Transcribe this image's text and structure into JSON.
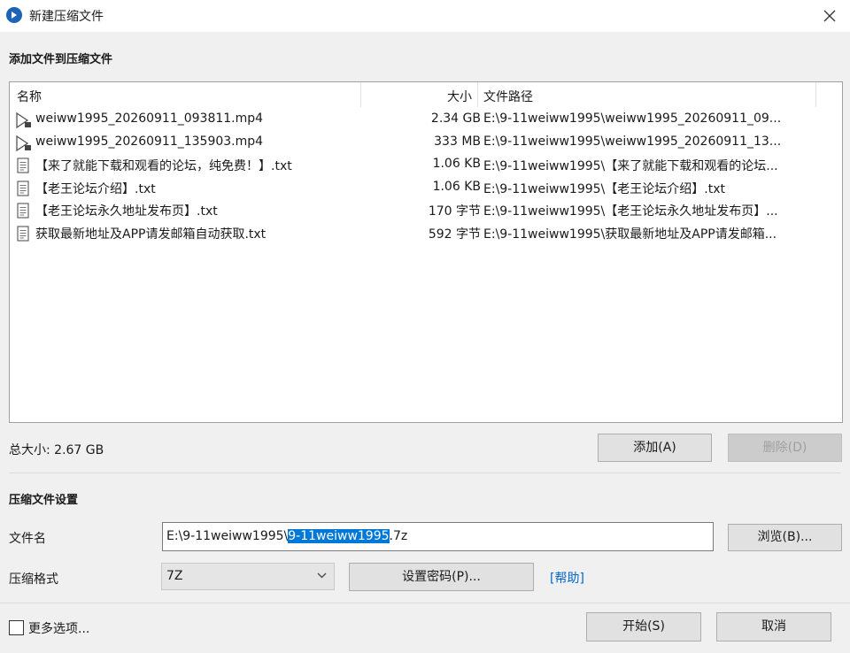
{
  "window": {
    "title": "新建压缩文件",
    "close_icon": "close-icon",
    "app_icon": "app-logo-icon"
  },
  "add_section": {
    "title": "添加文件到压缩文件"
  },
  "file_list": {
    "columns": {
      "name": "名称",
      "size": "大小",
      "path": "文件路径"
    },
    "rows": [
      {
        "icon": "video-file-icon",
        "name": "weiww1995_20260911_093811.mp4",
        "size": "2.34 GB",
        "path": "E:\\9-11weiww1995\\weiww1995_20260911_09..."
      },
      {
        "icon": "video-file-icon",
        "name": "weiww1995_20260911_135903.mp4",
        "size": "333 MB",
        "path": "E:\\9-11weiww1995\\weiww1995_20260911_13..."
      },
      {
        "icon": "text-file-icon",
        "name": "【来了就能下载和观看的论坛，纯免费！】.txt",
        "size": "1.06 KB",
        "path": "E:\\9-11weiww1995\\【来了就能下载和观看的论坛..."
      },
      {
        "icon": "text-file-icon",
        "name": "【老王论坛介绍】.txt",
        "size": "1.06 KB",
        "path": "E:\\9-11weiww1995\\【老王论坛介绍】.txt"
      },
      {
        "icon": "text-file-icon",
        "name": "【老王论坛永久地址发布页】.txt",
        "size": "170 字节",
        "path": "E:\\9-11weiww1995\\【老王论坛永久地址发布页】..."
      },
      {
        "icon": "text-file-icon",
        "name": "获取最新地址及APP请发邮箱自动获取.txt",
        "size": "592 字节",
        "path": "E:\\9-11weiww1995\\获取最新地址及APP请发邮箱..."
      }
    ]
  },
  "summary": {
    "total": "总大小: 2.67 GB"
  },
  "buttons": {
    "add": "添加(A)",
    "delete": "删除(D)",
    "browse": "浏览(B)...",
    "set_password": "设置密码(P)...",
    "start": "开始(S)",
    "cancel": "取消"
  },
  "settings": {
    "title": "压缩文件设置",
    "filename_label": "文件名",
    "filename_prefix": "E:\\9-11weiww1995\\",
    "filename_selected": "9-11weiww1995",
    "filename_suffix": ".7z",
    "format_label": "压缩格式",
    "format_value": "7Z",
    "help_link": "[帮助]"
  },
  "more_options": {
    "label": "更多选项...",
    "checked": false
  },
  "colors": {
    "selection": "#0078d7",
    "link": "#0066cc",
    "app_icon": "#1d63b8"
  }
}
